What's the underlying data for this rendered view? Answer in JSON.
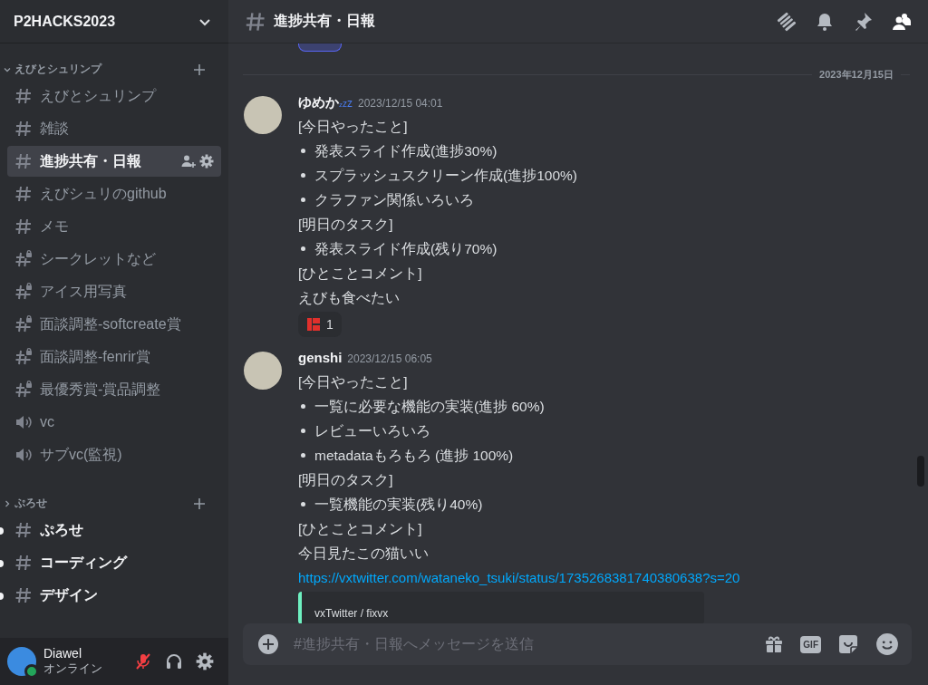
{
  "server": {
    "name": "P2HACKS2023"
  },
  "categories": [
    {
      "name": "えびとシュリンプ",
      "expanded": true,
      "channels": [
        {
          "kind": "text",
          "name": "えびとシュリンプ",
          "selected": false,
          "unread": false
        },
        {
          "kind": "text",
          "name": "雑談",
          "selected": false,
          "unread": false
        },
        {
          "kind": "text",
          "name": "進捗共有・日報",
          "selected": true,
          "unread": false
        },
        {
          "kind": "text",
          "name": "えびシュリのgithub",
          "selected": false,
          "unread": false
        },
        {
          "kind": "text",
          "name": "メモ",
          "selected": false,
          "unread": false
        },
        {
          "kind": "locked",
          "name": "シークレットなど",
          "selected": false,
          "unread": false
        },
        {
          "kind": "locked",
          "name": "アイス用写真",
          "selected": false,
          "unread": false
        },
        {
          "kind": "locked",
          "name": "面談調整-softcreate賞",
          "selected": false,
          "unread": false
        },
        {
          "kind": "locked",
          "name": "面談調整-fenrir賞",
          "selected": false,
          "unread": false
        },
        {
          "kind": "locked",
          "name": "最優秀賞-賞品調整",
          "selected": false,
          "unread": false
        },
        {
          "kind": "voice",
          "name": "vc",
          "selected": false,
          "unread": false
        },
        {
          "kind": "voice",
          "name": "サブvc(監視)",
          "selected": false,
          "unread": false
        }
      ]
    },
    {
      "name": "ぷろせ",
      "expanded": false,
      "channels": [
        {
          "kind": "text",
          "name": "ぷろせ",
          "selected": false,
          "unread": true
        },
        {
          "kind": "text",
          "name": "コーディング",
          "selected": false,
          "unread": true
        },
        {
          "kind": "text",
          "name": "デザイン",
          "selected": false,
          "unread": true
        }
      ]
    }
  ],
  "user": {
    "name": "Diawel",
    "status": "オンライン",
    "muted": true
  },
  "channel_header": {
    "title": "進捗共有・日報"
  },
  "date_divider": "2023年12月15日",
  "messages": [
    {
      "author": "ゆめか",
      "status_emoji": "zzz",
      "timestamp": "2023/12/15 04:01",
      "lines": [
        {
          "kind": "text",
          "text": "[今日やったこと]"
        },
        {
          "kind": "bullet",
          "text": "発表スライド作成(進捗30%)"
        },
        {
          "kind": "bullet",
          "text": "スプラッシュスクリーン作成(進捗100%)"
        },
        {
          "kind": "bullet",
          "text": "クラファン関係いろいろ"
        },
        {
          "kind": "text",
          "text": "[明日のタスク]"
        },
        {
          "kind": "bullet",
          "text": "発表スライド作成(残り70%)"
        },
        {
          "kind": "text",
          "text": "[ひとことコメント]"
        },
        {
          "kind": "text",
          "text": "えびも食べたい"
        }
      ],
      "reactions": [
        {
          "count": "1",
          "selected": false
        }
      ]
    },
    {
      "author": "genshi",
      "timestamp": "2023/12/15 06:05",
      "lines": [
        {
          "kind": "text",
          "text": "[今日やったこと]"
        },
        {
          "kind": "bullet",
          "text": "一覧に必要な機能の実装(進捗 60%)"
        },
        {
          "kind": "bullet",
          "text": "レビューいろいろ"
        },
        {
          "kind": "bullet",
          "text": "metadataもろもろ (進捗 100%)"
        },
        {
          "kind": "text",
          "text": "[明日のタスク]"
        },
        {
          "kind": "bullet",
          "text": "一覧機能の実装(残り40%)"
        },
        {
          "kind": "text",
          "text": "[ひとことコメント]"
        },
        {
          "kind": "text",
          "text": "今日見たこの猫いい"
        },
        {
          "kind": "link",
          "text": "https://vxtwitter.com/wataneko_tsuki/status/1735268381740380638?s=20"
        }
      ],
      "embed": {
        "provider": "vxTwitter / fixvx",
        "color": "#6ef0c0"
      }
    }
  ],
  "composer": {
    "placeholder": "#進捗共有・日報へメッセージを送信",
    "gif_label": "GIF"
  }
}
